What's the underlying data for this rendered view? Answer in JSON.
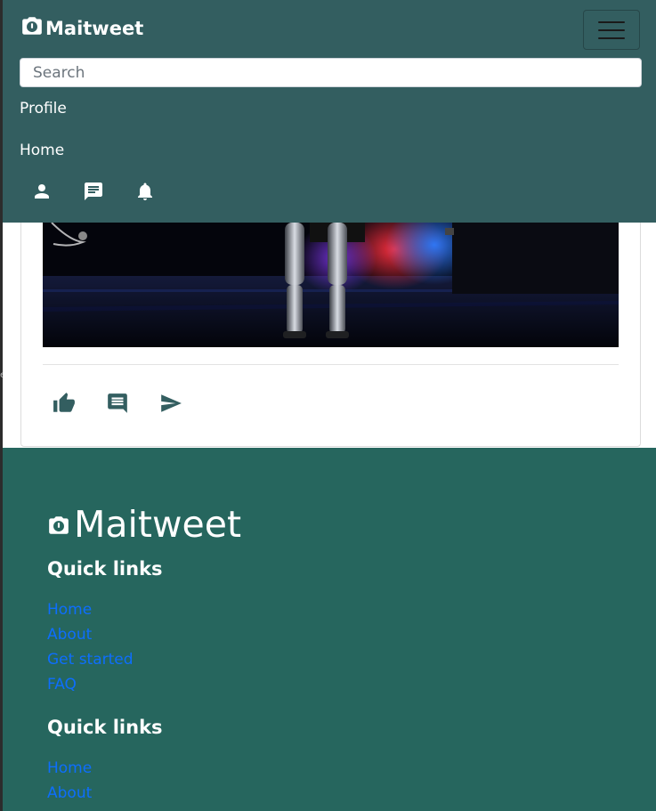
{
  "colors": {
    "nav_bg": "#335e60",
    "footer_bg": "#26665e",
    "accent": "#335e60",
    "link": "#0d6efd"
  },
  "navbar": {
    "brand": "Maitweet",
    "search_placeholder": "Search",
    "links": [
      "Profile",
      "Home"
    ],
    "icons": [
      "person-icon",
      "chat-icon",
      "bell-icon"
    ]
  },
  "post": {
    "actions": [
      "like-icon",
      "comment-icon",
      "send-icon"
    ]
  },
  "footer": {
    "brand": "Maitweet",
    "sections": [
      {
        "heading": "Quick links",
        "links": [
          "Home",
          "About",
          "Get started",
          "FAQ"
        ]
      },
      {
        "heading": "Quick links",
        "links": [
          "Home",
          "About"
        ]
      }
    ]
  }
}
